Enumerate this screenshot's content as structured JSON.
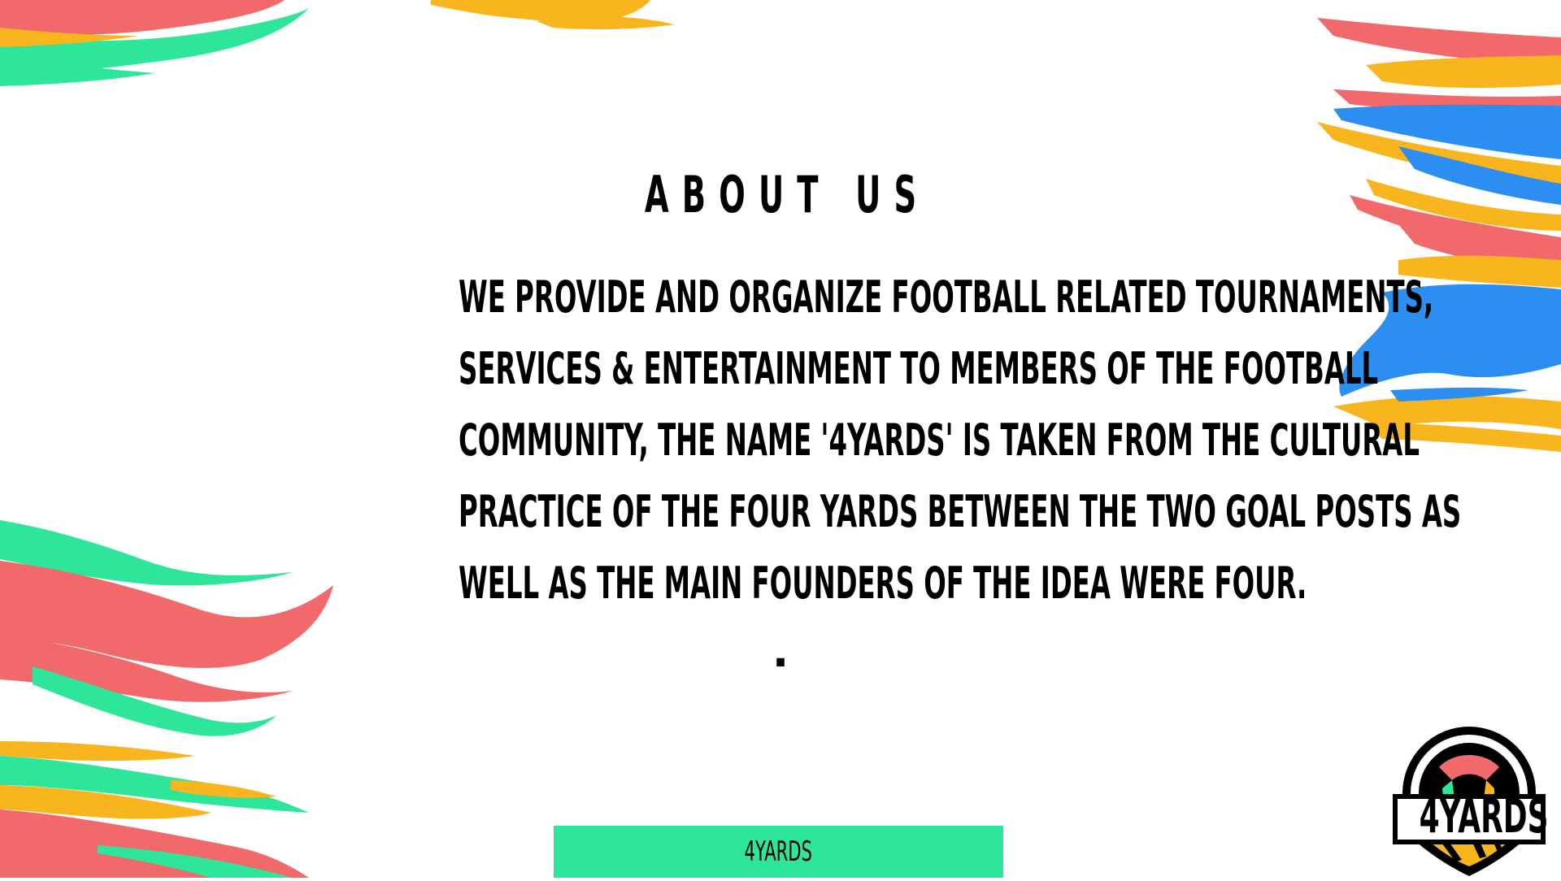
{
  "slide": {
    "title": "ABOUT US",
    "body_lines": [
      "WE PROVIDE AND ORGANIZE FOOTBALL RELATED TOURNAMENTS,",
      "SERVICES & ENTERTAINMENT TO MEMBERS OF THE FOOTBALL",
      "COMMUNITY, THE NAME '4YARDS' IS TAKEN FROM THE CULTURAL",
      "PRACTICE OF THE FOUR YARDS BETWEEN THE TWO GOAL POSTS AS",
      "WELL AS THE MAIN FOUNDERS OF THE IDEA WERE FOUR."
    ],
    "trailing_mark": "."
  },
  "footer": {
    "label": "4YARDS"
  },
  "logo": {
    "text": "4YARDS"
  },
  "colors": {
    "background": "#FFFFFF",
    "text": "#000000",
    "brush_red": "#F2696B",
    "brush_green": "#2DE69A",
    "brush_yellow": "#F9B51E",
    "brush_blue": "#2B8EF0",
    "footer_bar": "#2DE69A"
  }
}
